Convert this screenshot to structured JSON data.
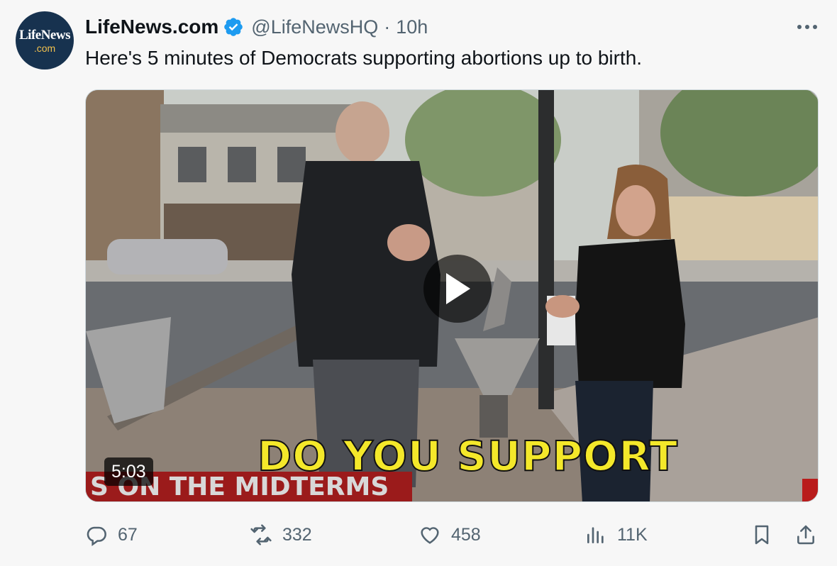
{
  "author": {
    "avatar_line1": "LifeNews",
    "avatar_line2": ".com",
    "name": "LifeNews.com",
    "handle": "@LifeNewsHQ",
    "separator": "·",
    "time": "10h"
  },
  "tweet": {
    "text": "Here's 5 minutes of Democrats supporting abortions up to birth."
  },
  "video": {
    "duration": "5:03",
    "caption": "DO YOU SUPPORT",
    "ticker": "S ON THE MIDTERMS"
  },
  "actions": {
    "replies": "67",
    "retweets": "332",
    "likes": "458",
    "views": "11K"
  },
  "colors": {
    "verified": "#1d9bf0",
    "caption": "#f4e82a",
    "ticker_bg": "#9b1b1b",
    "secondary_text": "#536471"
  },
  "icons": [
    "verified-badge-icon",
    "more-icon",
    "play-icon",
    "reply-icon",
    "retweet-icon",
    "like-icon",
    "views-icon",
    "bookmark-icon",
    "share-icon"
  ]
}
